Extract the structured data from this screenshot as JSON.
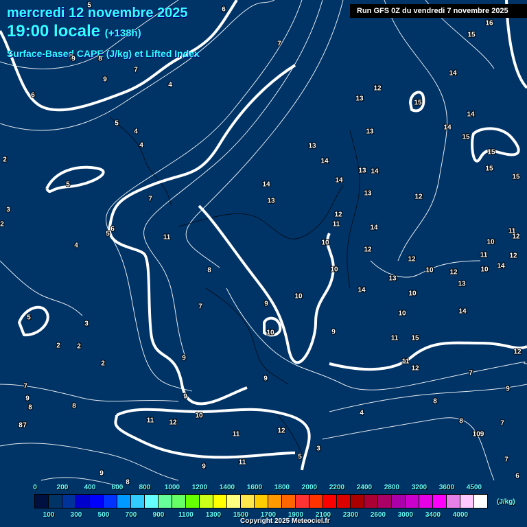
{
  "header": {
    "date": "mercredi 12 novembre 2025",
    "time": "19:00 locale",
    "offset": "(+138h)",
    "product": "Surface-Based CAPE (J/kg) et Lifted Index",
    "run": "Run GFS 0Z du vendredi 7 novembre 2025"
  },
  "map": {
    "background_color": "#003366",
    "lifted_index_labels": [
      "5",
      "6",
      "7",
      "16",
      "15",
      "7",
      "8",
      "9",
      "7",
      "9",
      "6",
      "4",
      "14",
      "12",
      "13",
      "15",
      "5",
      "4",
      "4",
      "13",
      "14",
      "14",
      "15",
      "15",
      "13",
      "14",
      "13",
      "14",
      "14",
      "14",
      "15",
      "15",
      "2",
      "5",
      "13",
      "12",
      "13",
      "7",
      "3",
      "12",
      "11",
      "14",
      "2",
      "5",
      "6",
      "11",
      "11",
      "10",
      "12",
      "10",
      "12",
      "4",
      "11",
      "12",
      "14",
      "12",
      "8",
      "10",
      "10",
      "12",
      "10",
      "13",
      "13",
      "14",
      "10",
      "10",
      "7",
      "9",
      "14",
      "10",
      "5",
      "3",
      "10",
      "9",
      "11",
      "15",
      "2",
      "2",
      "2",
      "9",
      "12",
      "11",
      "12",
      "7",
      "9",
      "7",
      "9",
      "8",
      "8",
      "9",
      "8",
      "9",
      "4",
      "10",
      "11",
      "12",
      "8",
      "7",
      "12",
      "11",
      "8",
      "109",
      "7",
      "3",
      "5",
      "11",
      "9",
      "9",
      "7",
      "6",
      "8"
    ]
  },
  "legend": {
    "unit": "(J/kg)",
    "top_labels": [
      "0",
      "200",
      "400",
      "600",
      "800",
      "1000",
      "1200",
      "1400",
      "1600",
      "1800",
      "2000",
      "2200",
      "2400",
      "2800",
      "3200",
      "3600",
      "4500"
    ],
    "bottom_labels": [
      "100",
      "300",
      "500",
      "700",
      "900",
      "1100",
      "1300",
      "1500",
      "1700",
      "1900",
      "2100",
      "2300",
      "2600",
      "3000",
      "3400",
      "4000"
    ],
    "colors": [
      "#001040",
      "#003366",
      "#003399",
      "#0000cc",
      "#0000ff",
      "#0033ff",
      "#0099ff",
      "#33ccff",
      "#66ffff",
      "#66ff99",
      "#66ff66",
      "#66ff00",
      "#ccff19",
      "#ffff00",
      "#ffff80",
      "#ffe64d",
      "#ffcc00",
      "#ff9900",
      "#ff6600",
      "#ff3333",
      "#ff3300",
      "#ff0000",
      "#dd0000",
      "#aa0000",
      "#aa0033",
      "#aa0066",
      "#aa00aa",
      "#cc00cc",
      "#e600e6",
      "#ff00ff",
      "#e680e6",
      "#ffc8ff",
      "#ffffff"
    ]
  },
  "footer": {
    "copyright": "Copyright 2025 Meteociel.fr"
  }
}
